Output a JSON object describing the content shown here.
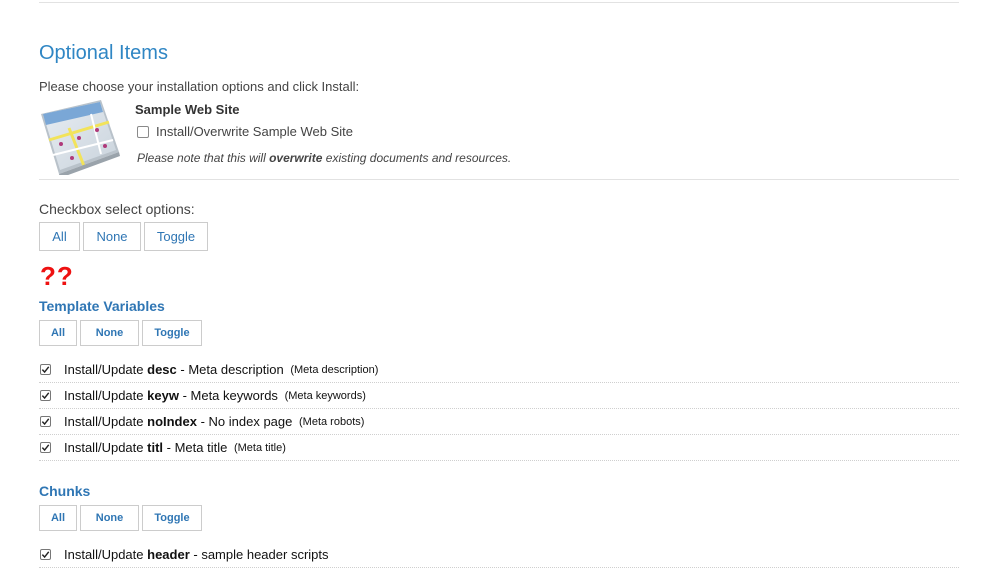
{
  "optional_items": {
    "title": "Optional Items",
    "instructions": "Please choose your installation options and click Install:"
  },
  "sample_site": {
    "title": "Sample Web Site",
    "checkbox_label": "Install/Overwrite Sample Web Site",
    "checked": false,
    "note_prefix": "Please note that this will ",
    "note_bold": "overwrite",
    "note_suffix": " existing documents and resources."
  },
  "checkbox_select": {
    "label": "Checkbox select options:",
    "all": "All",
    "none": "None",
    "toggle": "Toggle"
  },
  "error_marks": "??",
  "template_variables": {
    "title": "Template Variables",
    "all": "All",
    "none": "None",
    "toggle": "Toggle",
    "items": [
      {
        "prefix": "Install/Update ",
        "name": "desc",
        "desc": " - Meta description",
        "small": "(Meta description)",
        "checked": true
      },
      {
        "prefix": "Install/Update ",
        "name": "keyw",
        "desc": " - Meta keywords",
        "small": "(Meta keywords)",
        "checked": true
      },
      {
        "prefix": "Install/Update ",
        "name": "noIndex",
        "desc": " - No index page",
        "small": "(Meta robots)",
        "checked": true
      },
      {
        "prefix": "Install/Update ",
        "name": "titl",
        "desc": " - Meta title",
        "small": "(Meta title)",
        "checked": true
      }
    ]
  },
  "chunks": {
    "title": "Chunks",
    "all": "All",
    "none": "None",
    "toggle": "Toggle",
    "items": [
      {
        "prefix": "Install/Update ",
        "name": "header",
        "desc": " - sample header scripts",
        "small": "",
        "checked": true
      }
    ]
  },
  "colors": {
    "accent": "#2f86c4",
    "link": "#2f76b4",
    "error": "#ee1111"
  }
}
